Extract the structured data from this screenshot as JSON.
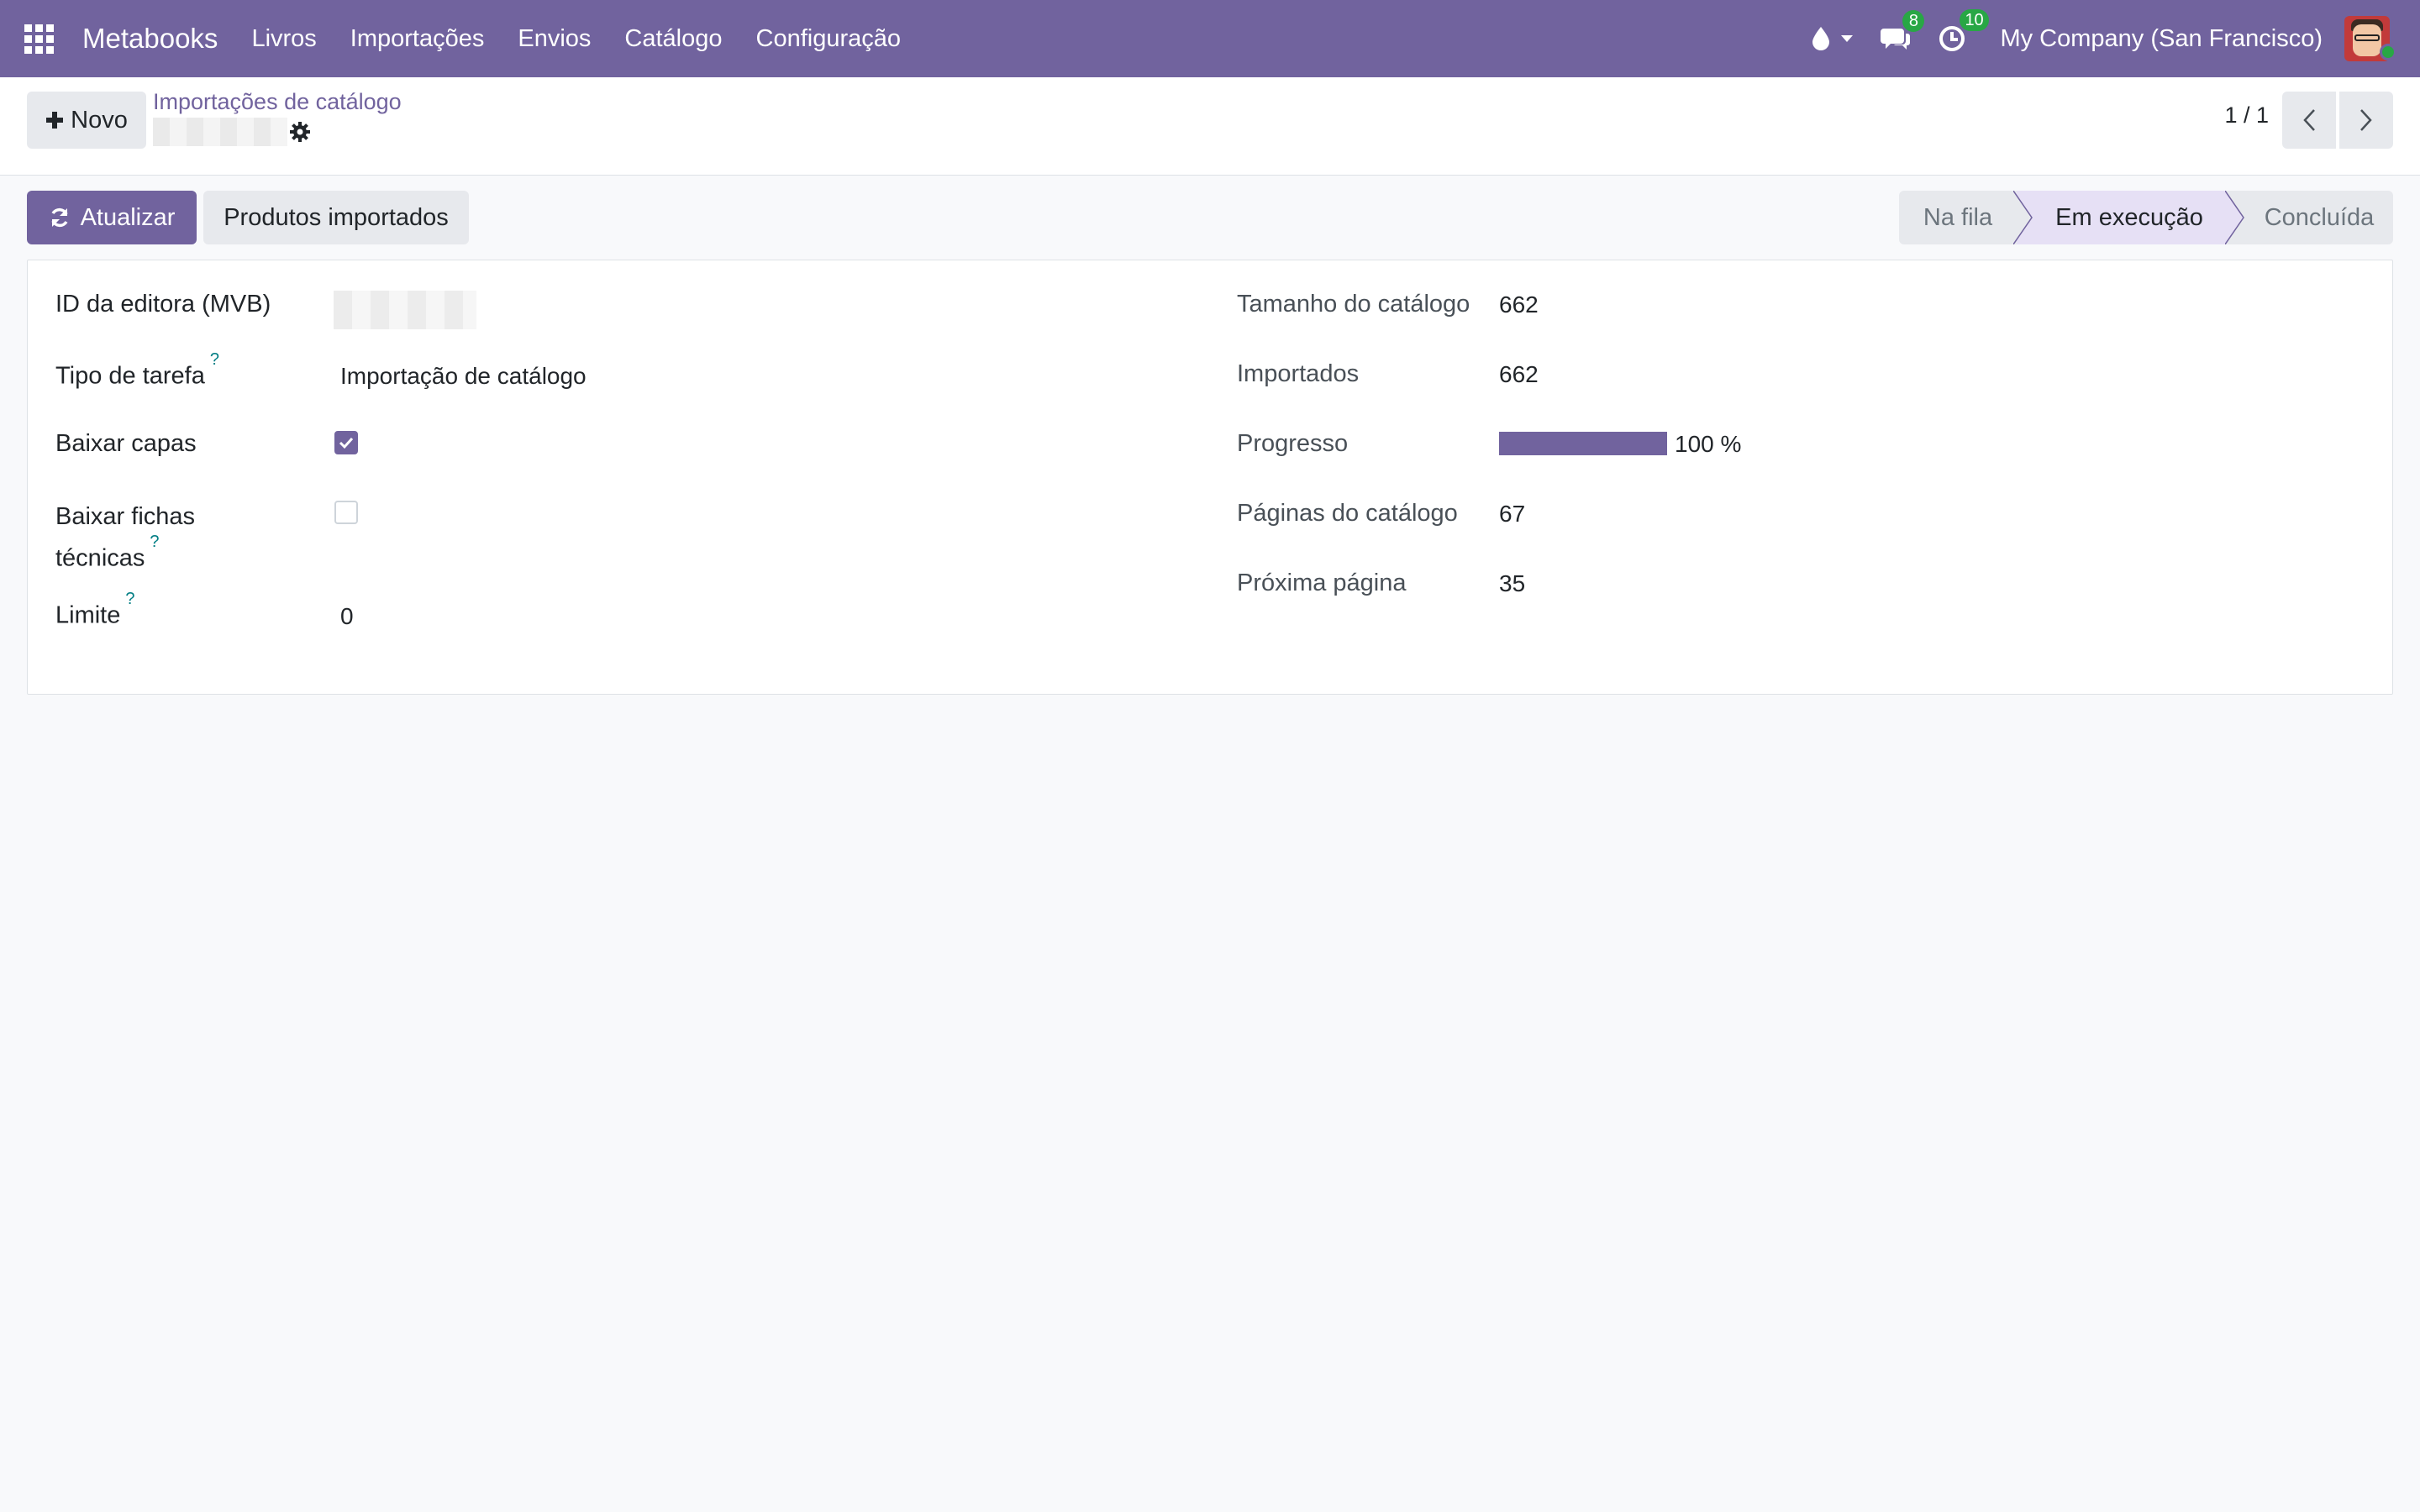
{
  "navbar": {
    "brand": "Metabooks",
    "menu": [
      "Livros",
      "Importações",
      "Envios",
      "Catálogo",
      "Configuração"
    ],
    "messages_count": "8",
    "activities_count": "10",
    "company": "My Company (San Francisco)"
  },
  "control_panel": {
    "new_button": "Novo",
    "breadcrumb": "Importações de catálogo",
    "pager": "1 / 1"
  },
  "actions": {
    "refresh_label": "Atualizar",
    "imported_products_label": "Produtos importados"
  },
  "statusbar": {
    "stages": [
      "Na fila",
      "Em execução",
      "Concluída"
    ],
    "current": "Em execução"
  },
  "form": {
    "left": {
      "publisher_id_label": "ID da editora (MVB)",
      "task_type_label": "Tipo de tarefa",
      "task_type_value": "Importação de catálogo",
      "download_covers_label": "Baixar capas",
      "download_covers_value": true,
      "download_sheets_label_1": "Baixar fichas",
      "download_sheets_label_2": "técnicas",
      "download_sheets_value": false,
      "limit_label": "Limite",
      "limit_value": "0",
      "help_mark": "?"
    },
    "right": {
      "catalog_size_label": "Tamanho do catálogo",
      "catalog_size_value": "662",
      "imported_label": "Importados",
      "imported_value": "662",
      "progress_label": "Progresso",
      "progress_value": 100,
      "progress_text": "100 %",
      "catalog_pages_label": "Páginas do catálogo",
      "catalog_pages_value": "67",
      "next_page_label": "Próxima página",
      "next_page_value": "35"
    }
  },
  "colors": {
    "brand": "#71639e",
    "badge": "#28a745",
    "help": "#017e84"
  }
}
